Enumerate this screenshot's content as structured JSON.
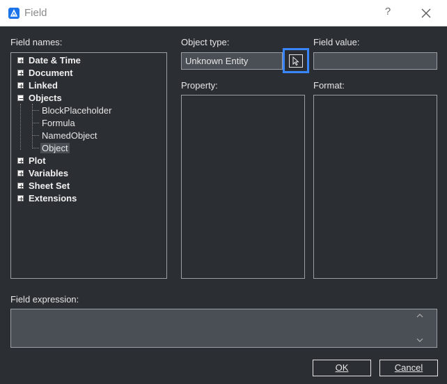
{
  "window": {
    "title": "Field",
    "help_label": "?"
  },
  "labels": {
    "field_names": "Field names:",
    "object_type": "Object type:",
    "field_value": "Field value:",
    "property": "Property:",
    "format": "Format:",
    "field_expression": "Field expression:"
  },
  "tree": {
    "items": [
      {
        "label": "Date & Time",
        "expanded": false
      },
      {
        "label": "Document",
        "expanded": false
      },
      {
        "label": "Linked",
        "expanded": false
      },
      {
        "label": "Objects",
        "expanded": true
      },
      {
        "label": "Plot",
        "expanded": false
      },
      {
        "label": "Variables",
        "expanded": false
      },
      {
        "label": "Sheet Set",
        "expanded": false
      },
      {
        "label": "Extensions",
        "expanded": false
      }
    ],
    "objects_children": [
      "BlockPlaceholder",
      "Formula",
      "NamedObject",
      "Object"
    ],
    "selected": "Object"
  },
  "object_type": {
    "value": "Unknown Entity"
  },
  "field_value": {
    "value": ""
  },
  "field_expression": {
    "value": ""
  },
  "buttons": {
    "ok": "OK",
    "cancel": "Cancel"
  },
  "colors": {
    "background": "#2b2e33",
    "field": "#4a4f55",
    "accent": "#3a86ff",
    "app_icon": "#1a73e8"
  },
  "icons": {
    "app": "app-icon",
    "help": "help-icon",
    "close": "close-icon",
    "pick": "select-object-icon"
  }
}
